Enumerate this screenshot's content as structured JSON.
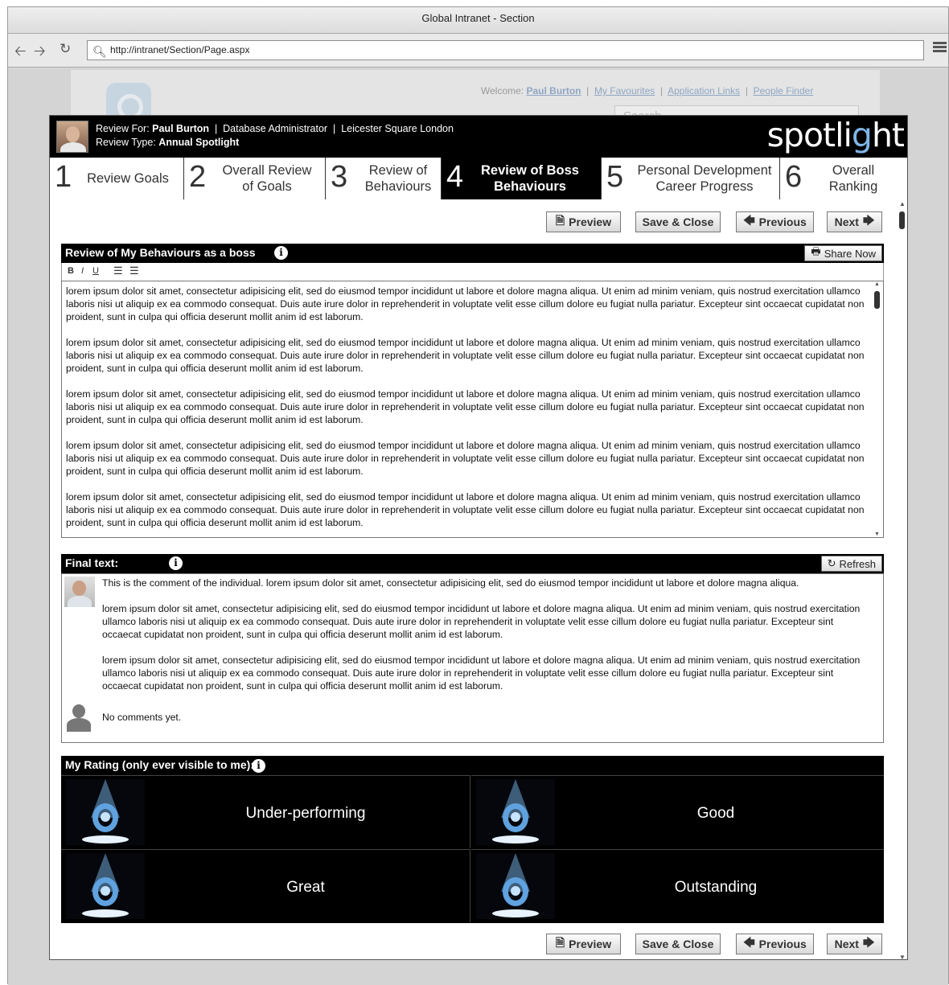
{
  "window": {
    "title": "Global Intranet - Section"
  },
  "browser": {
    "url": "http://intranet/Section/Page.aspx",
    "back_icon": "arrow-left-icon",
    "forward_icon": "arrow-right-icon",
    "reload_icon": "reload-icon"
  },
  "intranet": {
    "welcome_label": "Welcome:",
    "user_name": "Paul Burton",
    "links": [
      "My Favourites",
      "Application Links",
      "People Finder"
    ],
    "search_placeholder": "Search"
  },
  "review": {
    "review_for_label": "Review For:",
    "employee_name": "Paul Burton",
    "role": "Database Administrator",
    "location": "Leicester Square London",
    "review_type_label": "Review Type:",
    "review_type": "Annual Spotlight",
    "brand": {
      "pre": "spotli",
      "g": "g",
      "post": "ht"
    }
  },
  "tabs": [
    {
      "num": "1",
      "line1": "Review Goals",
      "line2": ""
    },
    {
      "num": "2",
      "line1": "Overall Review",
      "line2": "of Goals"
    },
    {
      "num": "3",
      "line1": "Review of",
      "line2": "Behaviours"
    },
    {
      "num": "4",
      "line1": "Review of Boss",
      "line2": "Behaviours"
    },
    {
      "num": "5",
      "line1": "Personal Development",
      "line2": "Career Progress"
    },
    {
      "num": "6",
      "line1": "Overall",
      "line2": "Ranking"
    }
  ],
  "active_tab": 3,
  "actions": {
    "preview": "Preview",
    "save_close": "Save & Close",
    "previous": "Previous",
    "next": "Next"
  },
  "behaviours_section": {
    "title": "Review of My Behaviours as a boss",
    "share_label": "Share Now",
    "toolbar": {
      "bold": "B",
      "italic": "I",
      "underline": "U"
    },
    "paragraphs": [
      "lorem ipsum dolor sit amet, consectetur adipisicing elit, sed do eiusmod tempor incididunt ut labore et dolore magna aliqua. Ut enim ad minim veniam, quis nostrud exercitation ullamco laboris nisi ut aliquip ex ea commodo consequat. Duis aute irure dolor in reprehenderit in voluptate velit esse cillum dolore eu fugiat nulla pariatur. Excepteur sint occaecat cupidatat non proident, sunt in culpa qui officia deserunt mollit anim id est laborum.",
      "lorem ipsum dolor sit amet, consectetur adipisicing elit, sed do eiusmod tempor incididunt ut labore et dolore magna aliqua. Ut enim ad minim veniam, quis nostrud exercitation ullamco laboris nisi ut aliquip ex ea commodo consequat. Duis aute irure dolor in reprehenderit in voluptate velit esse cillum dolore eu fugiat nulla pariatur. Excepteur sint occaecat cupidatat non proident, sunt in culpa qui officia deserunt mollit anim id est laborum.",
      "lorem ipsum dolor sit amet, consectetur adipisicing elit, sed do eiusmod tempor incididunt ut labore et dolore magna aliqua. Ut enim ad minim veniam, quis nostrud exercitation ullamco laboris nisi ut aliquip ex ea commodo consequat. Duis aute irure dolor in reprehenderit in voluptate velit esse cillum dolore eu fugiat nulla pariatur. Excepteur sint occaecat cupidatat non proident, sunt in culpa qui officia deserunt mollit anim id est laborum.",
      "lorem ipsum dolor sit amet, consectetur adipisicing elit, sed do eiusmod tempor incididunt ut labore et dolore magna aliqua. Ut enim ad minim veniam, quis nostrud exercitation ullamco laboris nisi ut aliquip ex ea commodo consequat. Duis aute irure dolor in reprehenderit in voluptate velit esse cillum dolore eu fugiat nulla pariatur. Excepteur sint occaecat cupidatat non proident, sunt in culpa qui officia deserunt mollit anim id est laborum.",
      "lorem ipsum dolor sit amet, consectetur adipisicing elit, sed do eiusmod tempor incididunt ut labore et dolore magna aliqua. Ut enim ad minim veniam, quis nostrud exercitation ullamco laboris nisi ut aliquip ex ea commodo consequat. Duis aute irure dolor in reprehenderit in voluptate velit esse cillum dolore eu fugiat nulla pariatur. Excepteur sint occaecat cupidatat non proident, sunt in culpa qui officia deserunt mollit anim id est laborum."
    ]
  },
  "final_text": {
    "title": "Final text:",
    "refresh_label": "Refresh",
    "comment_intro": "This is the comment of the individual. lorem ipsum dolor sit amet, consectetur adipisicing elit, sed do eiusmod tempor incididunt ut labore et dolore magna aliqua.",
    "comment_paragraphs": [
      "lorem ipsum dolor sit amet, consectetur adipisicing elit, sed do eiusmod tempor incididunt ut labore et dolore magna aliqua. Ut enim ad minim veniam, quis nostrud exercitation ullamco laboris nisi ut aliquip ex ea commodo consequat. Duis aute irure dolor in reprehenderit in voluptate velit esse cillum dolore eu fugiat nulla pariatur. Excepteur sint occaecat cupidatat non proident, sunt in culpa qui officia deserunt mollit anim id est laborum.",
      "lorem ipsum dolor sit amet, consectetur adipisicing elit, sed do eiusmod tempor incididunt ut labore et dolore magna aliqua. Ut enim ad minim veniam, quis nostrud exercitation ullamco laboris nisi ut aliquip ex ea commodo consequat. Duis aute irure dolor in reprehenderit in voluptate velit esse cillum dolore eu fugiat nulla pariatur. Excepteur sint occaecat cupidatat non proident, sunt in culpa qui officia deserunt mollit anim id est laborum."
    ],
    "empty_comments": "No comments yet."
  },
  "rating": {
    "title": "My Rating (only ever visible to me):",
    "options": [
      "Under-performing",
      "Good",
      "Great",
      "Outstanding"
    ]
  }
}
